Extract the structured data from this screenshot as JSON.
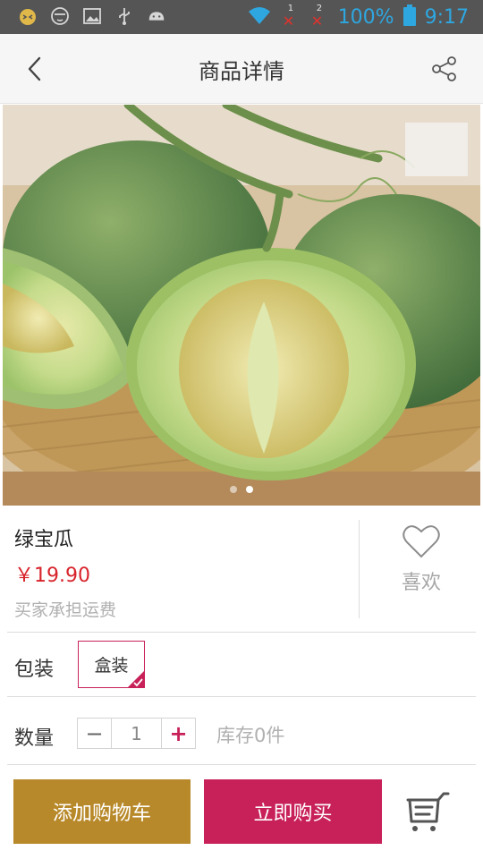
{
  "status_bar": {
    "battery": "100%",
    "time": "9:17",
    "sim1_label": "1",
    "sim2_label": "2",
    "left_icons": [
      "cat-face-icon",
      "mask-face-icon",
      "image-icon",
      "usb-icon",
      "android-icon"
    ],
    "right_icons": [
      "wifi-icon",
      "signal-sim1-icon",
      "signal-sim2-icon",
      "battery-icon"
    ]
  },
  "header": {
    "title": "商品详情",
    "back_icon": "chevron-left-icon",
    "share_icon": "share-icon"
  },
  "gallery": {
    "image": "green-melon-photo",
    "page_count": 2,
    "active_index": 1
  },
  "product": {
    "name": "绿宝瓜",
    "price": "￥19.90",
    "shipping": "买家承担运费"
  },
  "like": {
    "label": "喜欢",
    "icon": "heart-outline-icon"
  },
  "packaging": {
    "label": "包装",
    "selected_option": "盒装"
  },
  "quantity": {
    "label": "数量",
    "minus": "−",
    "value": "1",
    "plus": "+",
    "stock": "库存0件"
  },
  "actions": {
    "add_to_cart": "添加购物车",
    "buy_now": "立即购买",
    "cart_icon": "shopping-cart-icon"
  },
  "colors": {
    "accent": "#c8215a",
    "cart_button": "#b8892a",
    "price": "#d8242c",
    "status_bar": "#555555",
    "status_text": "#2ea7e0"
  }
}
